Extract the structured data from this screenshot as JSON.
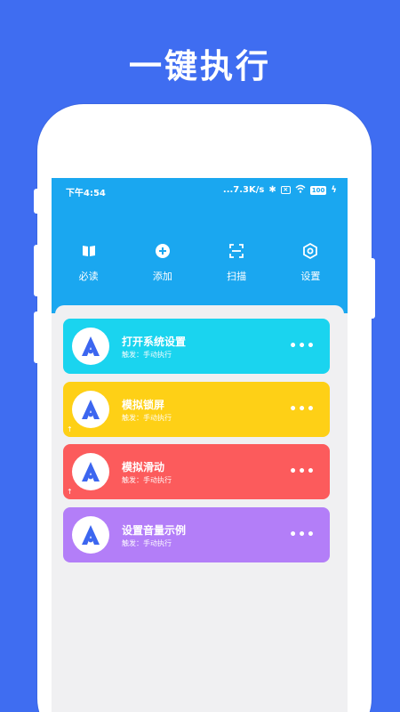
{
  "headline": "一键执行",
  "status": {
    "time": "下午4:54",
    "network": "...7.3K/s",
    "battery": "100"
  },
  "toolbar": [
    {
      "label": "必读",
      "icon": "book-icon"
    },
    {
      "label": "添加",
      "icon": "add-icon"
    },
    {
      "label": "扫描",
      "icon": "scan-icon"
    },
    {
      "label": "设置",
      "icon": "settings-icon"
    }
  ],
  "cards": [
    {
      "title": "打开系统设置",
      "subtitle": "触发：手动执行",
      "more": "•••",
      "color": "#1ad4ef",
      "pinned": false
    },
    {
      "title": "模拟锁屏",
      "subtitle": "触发：手动执行",
      "more": "•••",
      "color": "#fed016",
      "pinned": true
    },
    {
      "title": "模拟滑动",
      "subtitle": "触发：手动执行",
      "more": "•••",
      "color": "#fc5b5c",
      "pinned": true
    },
    {
      "title": "设置音量示例",
      "subtitle": "触发：手动执行",
      "more": "•••",
      "color": "#b37ef8",
      "pinned": false
    }
  ],
  "colors": {
    "background": "#3f6df1",
    "topbar": "#1aa7f0",
    "app_logo": "#3c66f0"
  }
}
